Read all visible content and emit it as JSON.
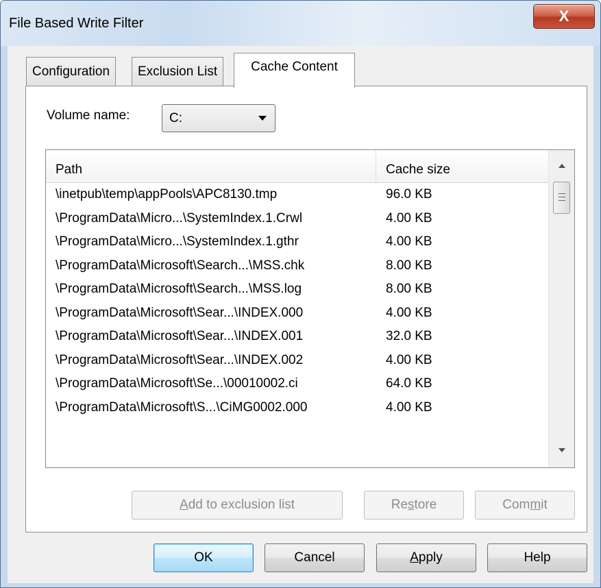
{
  "window": {
    "title": "File Based Write Filter",
    "close_glyph": "X"
  },
  "tabs": [
    {
      "label": "Configuration",
      "active": false
    },
    {
      "label": "Exclusion List",
      "active": false
    },
    {
      "label": "Cache Content",
      "active": true
    }
  ],
  "volume": {
    "label": "Volume name:",
    "selected": "C:"
  },
  "list": {
    "columns": {
      "path": "Path",
      "size": "Cache size"
    },
    "rows": [
      {
        "path": "\\inetpub\\temp\\appPools\\APC8130.tmp",
        "size": "96.0 KB"
      },
      {
        "path": "\\ProgramData\\Micro...\\SystemIndex.1.Crwl",
        "size": "4.00 KB"
      },
      {
        "path": "\\ProgramData\\Micro...\\SystemIndex.1.gthr",
        "size": "4.00 KB"
      },
      {
        "path": "\\ProgramData\\Microsoft\\Search...\\MSS.chk",
        "size": "8.00 KB"
      },
      {
        "path": "\\ProgramData\\Microsoft\\Search...\\MSS.log",
        "size": "8.00 KB"
      },
      {
        "path": "\\ProgramData\\Microsoft\\Sear...\\INDEX.000",
        "size": "4.00 KB"
      },
      {
        "path": "\\ProgramData\\Microsoft\\Sear...\\INDEX.001",
        "size": "32.0 KB"
      },
      {
        "path": "\\ProgramData\\Microsoft\\Sear...\\INDEX.002",
        "size": "4.00 KB"
      },
      {
        "path": "\\ProgramData\\Microsoft\\Se...\\00010002.ci",
        "size": "64.0 KB"
      },
      {
        "path": "\\ProgramData\\Microsoft\\S...\\CiMG0002.000",
        "size": "4.00 KB"
      }
    ]
  },
  "actions": {
    "add_pre": "",
    "add_key": "A",
    "add_post": "dd to exclusion list",
    "restore_pre": "Re",
    "restore_key": "s",
    "restore_post": "tore",
    "commit_pre": "Com",
    "commit_key": "m",
    "commit_post": "it"
  },
  "footer": {
    "ok": "OK",
    "cancel": "Cancel",
    "apply_key": "A",
    "apply_post": "pply",
    "help": "Help"
  }
}
